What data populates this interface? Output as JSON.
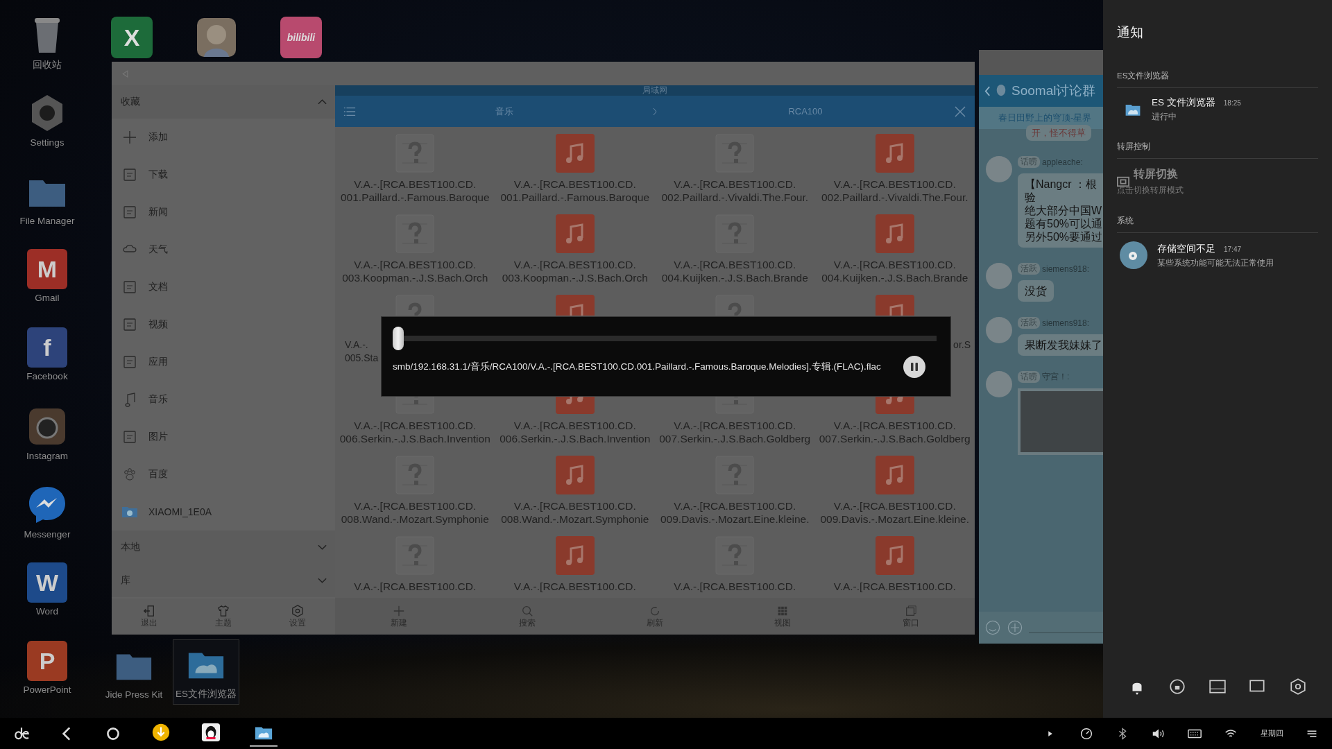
{
  "desktop": {
    "left_icons": [
      {
        "kind": "trash",
        "label": "回收站"
      },
      {
        "kind": "gear",
        "label": "Settings"
      },
      {
        "kind": "folder",
        "label": "File Manager"
      },
      {
        "kind": "mail",
        "label": "Gmail",
        "glyph": "M"
      },
      {
        "kind": "facebook",
        "label": "Facebook",
        "glyph": "f"
      },
      {
        "kind": "camera",
        "label": "Instagram"
      },
      {
        "kind": "messenger",
        "label": "Messenger"
      },
      {
        "kind": "word",
        "label": "Word",
        "glyph": "W"
      },
      {
        "kind": "powerpoint",
        "label": "PowerPoint",
        "glyph": "P"
      }
    ],
    "top_icons": [
      {
        "kind": "excel",
        "glyph": "X"
      },
      {
        "kind": "avatar"
      },
      {
        "kind": "bilibili",
        "glyph": "bilibili"
      }
    ],
    "bottom_icons": [
      {
        "kind": "folder",
        "label": "Jide Press Kit",
        "selected": false
      },
      {
        "kind": "es",
        "label": "ES文件浏览器",
        "selected": true
      }
    ]
  },
  "file_manager": {
    "sidebar": {
      "sections": [
        {
          "title": "收藏",
          "expanded": true,
          "items": [
            {
              "kind": "plus",
              "label": "添加"
            },
            {
              "kind": "download",
              "label": "下载"
            },
            {
              "kind": "news",
              "label": "新闻"
            },
            {
              "kind": "weather",
              "label": "天气"
            },
            {
              "kind": "doc",
              "label": "文档"
            },
            {
              "kind": "video",
              "label": "视频"
            },
            {
              "kind": "app",
              "label": "应用"
            },
            {
              "kind": "music",
              "label": "音乐"
            },
            {
              "kind": "image",
              "label": "图片"
            },
            {
              "kind": "paw",
              "label": "百度"
            },
            {
              "kind": "network",
              "label": "XIAOMI_1E0A"
            }
          ]
        },
        {
          "title": "本地",
          "expanded": false
        },
        {
          "title": "库",
          "expanded": false
        }
      ],
      "buttons": [
        {
          "kind": "exit",
          "label": "退出"
        },
        {
          "kind": "shirt",
          "label": "主题"
        },
        {
          "kind": "gear",
          "label": "设置"
        }
      ]
    },
    "location": "局域网",
    "breadcrumb": [
      "音乐",
      "RCA100"
    ],
    "files": [
      {
        "kind": "unknown",
        "lines": [
          "V.A.-.[RCA.BEST100.CD.",
          "001.Paillard.-.Famous.Baroque"
        ]
      },
      {
        "kind": "music",
        "lines": [
          "V.A.-.[RCA.BEST100.CD.",
          "001.Paillard.-.Famous.Baroque"
        ]
      },
      {
        "kind": "unknown",
        "lines": [
          "V.A.-.[RCA.BEST100.CD.",
          "002.Paillard.-.Vivaldi.The.Four."
        ]
      },
      {
        "kind": "music",
        "lines": [
          "V.A.-.[RCA.BEST100.CD.",
          "002.Paillard.-.Vivaldi.The.Four."
        ]
      },
      {
        "kind": "unknown",
        "lines": [
          "V.A.-.[RCA.BEST100.CD.",
          "003.Koopman.-.J.S.Bach.Orch"
        ]
      },
      {
        "kind": "music",
        "lines": [
          "V.A.-.[RCA.BEST100.CD.",
          "003.Koopman.-.J.S.Bach.Orch"
        ]
      },
      {
        "kind": "unknown",
        "lines": [
          "V.A.-.[RCA.BEST100.CD.",
          "004.Kuijken.-.J.S.Bach.Brande"
        ]
      },
      {
        "kind": "music",
        "lines": [
          "V.A.-.[RCA.BEST100.CD.",
          "004.Kuijken.-.J.S.Bach.Brande"
        ]
      },
      {
        "kind": "unknown",
        "covered": true,
        "lines": [
          "V.A.-.",
          "005.Sta"
        ]
      },
      {
        "kind": "music"
      },
      {
        "kind": "unknown"
      },
      {
        "kind": "music",
        "covered": true,
        "lines": [
          "or.S"
        ]
      },
      {
        "kind": "unknown",
        "lines": [
          "V.A.-.[RCA.BEST100.CD.",
          "006.Serkin.-.J.S.Bach.Invention"
        ]
      },
      {
        "kind": "music",
        "lines": [
          "V.A.-.[RCA.BEST100.CD.",
          "006.Serkin.-.J.S.Bach.Invention"
        ]
      },
      {
        "kind": "unknown",
        "lines": [
          "V.A.-.[RCA.BEST100.CD.",
          "007.Serkin.-.J.S.Bach.Goldberg"
        ]
      },
      {
        "kind": "music",
        "lines": [
          "V.A.-.[RCA.BEST100.CD.",
          "007.Serkin.-.J.S.Bach.Goldberg"
        ]
      },
      {
        "kind": "unknown",
        "lines": [
          "V.A.-.[RCA.BEST100.CD.",
          "008.Wand.-.Mozart.Symphonie"
        ]
      },
      {
        "kind": "music",
        "lines": [
          "V.A.-.[RCA.BEST100.CD.",
          "008.Wand.-.Mozart.Symphonie"
        ]
      },
      {
        "kind": "unknown",
        "lines": [
          "V.A.-.[RCA.BEST100.CD.",
          "009.Davis.-.Mozart.Eine.kleine."
        ]
      },
      {
        "kind": "music",
        "lines": [
          "V.A.-.[RCA.BEST100.CD.",
          "009.Davis.-.Mozart.Eine.kleine."
        ]
      },
      {
        "kind": "unknown",
        "lines": [
          "V.A.-.[RCA.BEST100.CD."
        ]
      },
      {
        "kind": "music",
        "lines": [
          "V.A.-.[RCA.BEST100.CD."
        ]
      },
      {
        "kind": "unknown",
        "lines": [
          "V.A.-.[RCA.BEST100.CD."
        ]
      },
      {
        "kind": "music",
        "lines": [
          "V.A.-.[RCA.BEST100.CD."
        ]
      }
    ],
    "toolbar": [
      {
        "kind": "plus",
        "label": "新建"
      },
      {
        "kind": "search",
        "label": "搜索"
      },
      {
        "kind": "refresh",
        "label": "刷新"
      },
      {
        "kind": "grid",
        "label": "视图"
      },
      {
        "kind": "windows",
        "label": "窗口"
      }
    ]
  },
  "player": {
    "level": 0,
    "path": "smb/192.168.31.1/音乐/RCA100/V.A.-.[RCA.BEST100.CD.001.Paillard.-.Famous.Baroque.Melodies].专辑.(FLAC).flac",
    "playing": true
  },
  "chat": {
    "title": "Soomal讨论群",
    "subtitle": "春日田野上的穹顶-星界",
    "messages": [
      {
        "kind": "text",
        "partial": true,
        "lines": [
          "开，怪不得草"
        ]
      },
      {
        "kind": "text",
        "badge": "话唠",
        "sender": "appleache:",
        "lines": [
          "【Nangcr ：根",
          "验",
          "绝大部分中国W",
          "题有50%可以通",
          "另外50%要通过"
        ]
      },
      {
        "kind": "text",
        "badge": "活跃",
        "sender": "siemens918:",
        "lines": [
          "没货"
        ]
      },
      {
        "kind": "text",
        "badge": "活跃",
        "sender": "siemens918:",
        "lines": [
          "果断发我妹妹了"
        ]
      },
      {
        "kind": "image",
        "badge": "话唠",
        "sender": "守宫！:"
      }
    ]
  },
  "notifications": {
    "title": "通知",
    "groups": [
      {
        "title": "ES文件浏览器",
        "items": [
          {
            "kind": "es",
            "name": "ES 文件浏览器",
            "time": "18:25",
            "text": "进行中"
          }
        ]
      },
      {
        "title": "转屏控制",
        "items": [
          {
            "kind": "rotate",
            "name": "转屏切换",
            "text": "点击切换转屏模式"
          }
        ]
      },
      {
        "title": "系统",
        "items": [
          {
            "kind": "storage",
            "name": "存储空间不足",
            "time": "17:47",
            "text": "某些系统功能可能无法正常使用"
          }
        ]
      }
    ],
    "quick_buttons": [
      {
        "kind": "bell"
      },
      {
        "kind": "rotate-lock"
      },
      {
        "kind": "screen"
      },
      {
        "kind": "window"
      },
      {
        "kind": "gear"
      }
    ]
  },
  "taskbar": {
    "apps": [
      {
        "kind": "download",
        "selected": false
      },
      {
        "kind": "penguin",
        "selected": false
      },
      {
        "kind": "es",
        "selected": true
      }
    ],
    "day": "星期四"
  }
}
